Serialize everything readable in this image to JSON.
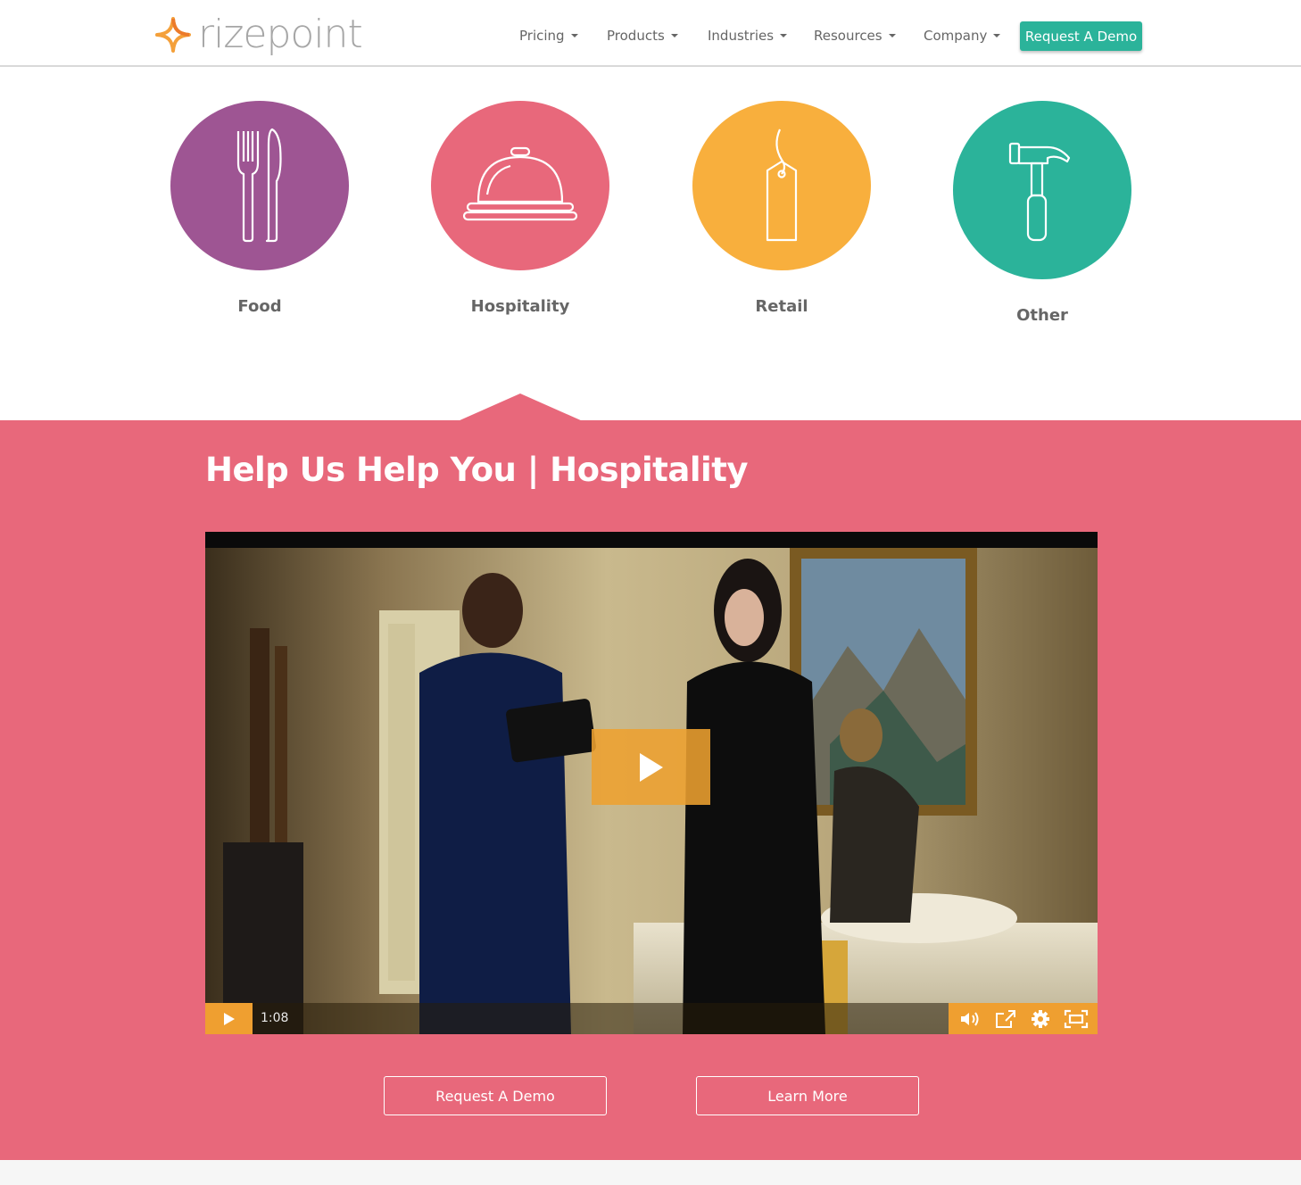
{
  "brand": {
    "logo_text": "rizepoint",
    "mark_colors": [
      "#f4a03a",
      "#ec7b2b"
    ]
  },
  "nav": {
    "items": [
      {
        "label": "Pricing"
      },
      {
        "label": "Products"
      },
      {
        "label": "Industries"
      },
      {
        "label": "Resources"
      },
      {
        "label": "Company"
      }
    ],
    "cta_label": "Request A Demo"
  },
  "industries": [
    {
      "label": "Food",
      "color": "#9e5593",
      "icon": "fork-knife-icon"
    },
    {
      "label": "Hospitality",
      "color": "#e8687b",
      "icon": "service-bell-icon"
    },
    {
      "label": "Retail",
      "color": "#f8af3d",
      "icon": "price-tag-icon"
    },
    {
      "label": "Other",
      "color": "#2bb39a",
      "icon": "hammer-icon"
    }
  ],
  "section": {
    "title": "Help Us Help You | Hospitality",
    "background": "#e8687b"
  },
  "video": {
    "duration": "1:08",
    "accent": "#ef9f30",
    "controls": [
      "play-icon",
      "volume-icon",
      "share-icon",
      "settings-icon",
      "fullscreen-icon"
    ]
  },
  "actions": {
    "request_demo_label": "Request A Demo",
    "learn_more_label": "Learn More"
  }
}
